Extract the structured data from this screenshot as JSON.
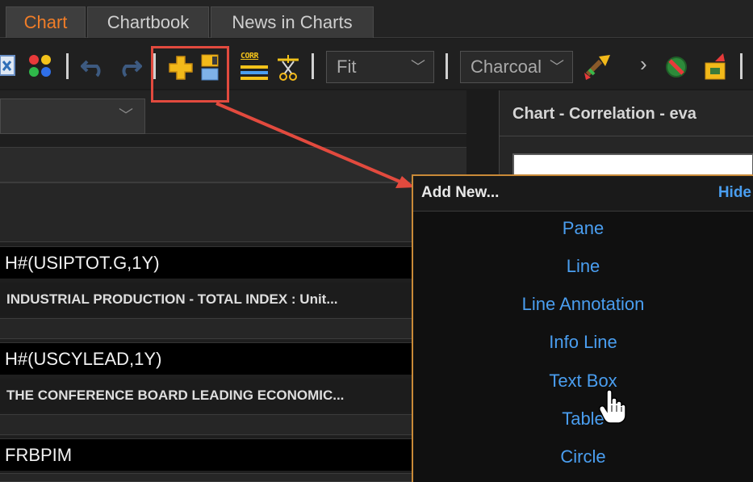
{
  "tabs": [
    {
      "label": "Chart",
      "active": true
    },
    {
      "label": "Chartbook",
      "active": false
    },
    {
      "label": "News in Charts",
      "active": false
    }
  ],
  "toolbar": {
    "zoom_value": "Fit",
    "theme_value": "Charcoal",
    "corr_icon_text": "CORR",
    "icons": [
      "excel-icon",
      "color-palette-icon",
      "undo-icon",
      "redo-icon",
      "add-new-icon",
      "layout-icon",
      "correlation-icon",
      "scissors-icon",
      "paintbrush-icon",
      "chevron-right-icon",
      "no-entry-icon",
      "export-icon"
    ],
    "highlight_color": "#e24a3e",
    "accent_orange": "#f07d28"
  },
  "left_panel": {
    "series": [
      {
        "code": "H#(USIPTOT.G,1Y)",
        "description": "INDUSTRIAL PRODUCTION - TOTAL INDEX : Unit..."
      },
      {
        "code": "H#(USCYLEAD,1Y)",
        "description": "THE CONFERENCE BOARD LEADING ECONOMIC..."
      },
      {
        "code": "FRBPIM",
        "description": ""
      }
    ]
  },
  "right_panel": {
    "title": "Chart - Correlation - eva"
  },
  "popup": {
    "title": "Add New...",
    "hide_label": "Hide",
    "items": [
      "Pane",
      "Line",
      "Line Annotation",
      "Info Line",
      "Text Box",
      "Table",
      "Circle"
    ],
    "link_color": "#4a9ef0",
    "border_color": "#c98a38"
  }
}
